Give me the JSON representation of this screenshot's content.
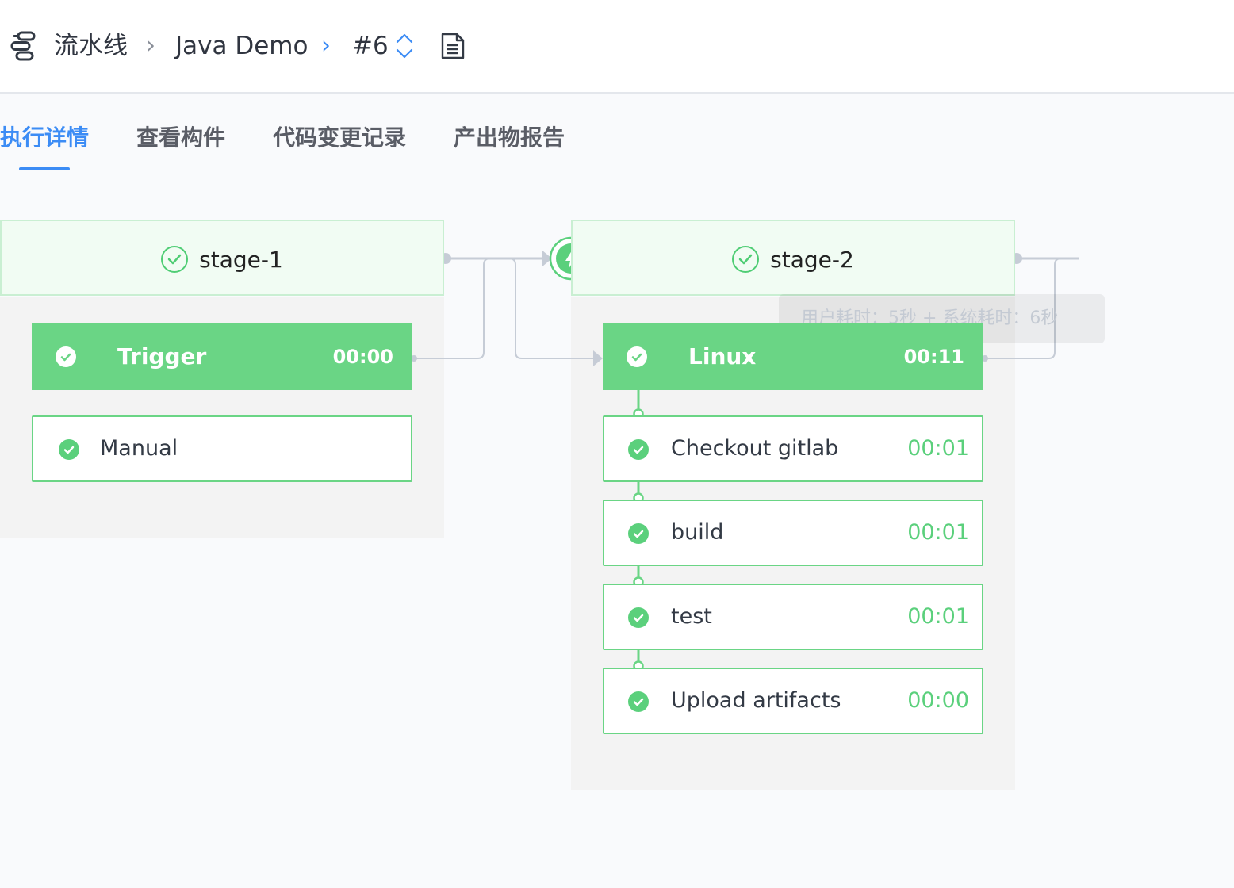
{
  "breadcrumb": {
    "pipeline_label": "流水线",
    "project_name": "Java Demo",
    "build_number": "#6"
  },
  "tabs": [
    {
      "label": "执行详情",
      "active": true
    },
    {
      "label": "查看构件",
      "active": false
    },
    {
      "label": "代码变更记录",
      "active": false
    },
    {
      "label": "产出物报告",
      "active": false
    }
  ],
  "stages": [
    {
      "name": "stage-1",
      "status": "success",
      "job": {
        "name": "Trigger",
        "time": "00:00"
      },
      "steps": [
        {
          "name": "Manual",
          "time": ""
        }
      ]
    },
    {
      "name": "stage-2",
      "status": "success",
      "job": {
        "name": "Linux",
        "time": "00:11"
      },
      "steps": [
        {
          "name": "Checkout gitlab",
          "time": "00:01"
        },
        {
          "name": "build",
          "time": "00:01"
        },
        {
          "name": "test",
          "time": "00:01"
        },
        {
          "name": "Upload artifacts",
          "time": "00:00"
        }
      ]
    }
  ],
  "tooltip": {
    "text": "用户耗时：5秒 + 系统耗时：6秒"
  },
  "colors": {
    "accent": "#3c8cf5",
    "success": "#5bd07c",
    "job_bg": "#6ad585",
    "connector": "#c6ccd6",
    "stage_head_bg": "#f1fcf3"
  },
  "icons": {
    "pipeline": "pipeline-icon",
    "separator": "chevron-right-icon",
    "switch": "up-down-switch-icon",
    "log": "document-icon",
    "trigger": "lightning-bolt-icon",
    "status": "check-circle-icon"
  }
}
